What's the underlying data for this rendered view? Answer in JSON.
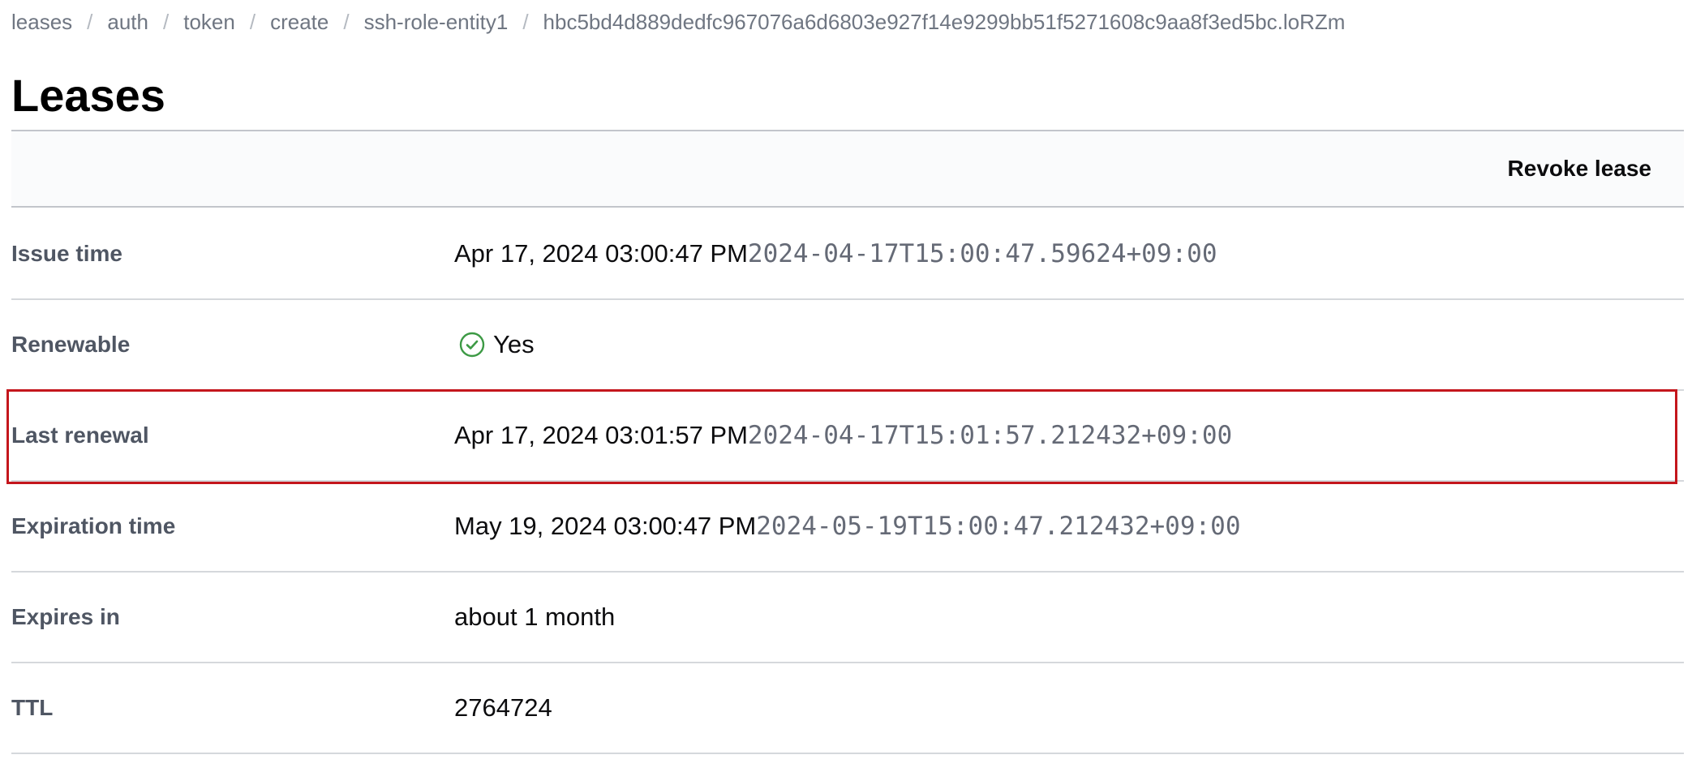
{
  "breadcrumb": {
    "items": [
      "leases",
      "auth",
      "token",
      "create",
      "ssh-role-entity1"
    ],
    "current": "hbc5bd4d889dedfc967076a6d6803e927f14e9299bb51f5271608c9aa8f3ed5bc.loRZm",
    "separator": "/"
  },
  "page": {
    "title": "Leases"
  },
  "toolbar": {
    "revoke_label": "Revoke lease"
  },
  "details": {
    "issue_time": {
      "label": "Issue time",
      "display": "Apr 17, 2024 03:00:47 PM",
      "raw": "2024-04-17T15:00:47.59624+09:00"
    },
    "renewable": {
      "label": "Renewable",
      "value": "Yes",
      "icon": "check-circle-icon",
      "icon_color": "#3d9a45"
    },
    "last_renewal": {
      "label": "Last renewal",
      "display": "Apr 17, 2024 03:01:57 PM",
      "raw": "2024-04-17T15:01:57.212432+09:00"
    },
    "expiration_time": {
      "label": "Expiration time",
      "display": "May 19, 2024 03:00:47 PM",
      "raw": "2024-05-19T15:00:47.212432+09:00"
    },
    "expires_in": {
      "label": "Expires in",
      "value": "about 1 month"
    },
    "ttl": {
      "label": "TTL",
      "value": "2764724"
    }
  },
  "colors": {
    "highlight": "#c4161c",
    "toolbar_bg": "#fafbfc"
  }
}
